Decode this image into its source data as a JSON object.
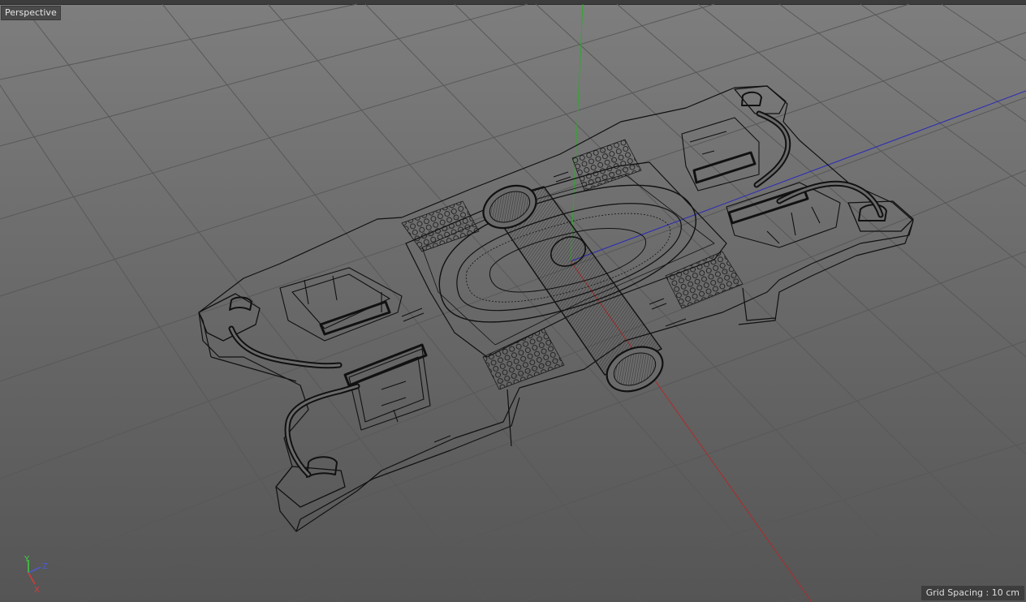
{
  "viewport": {
    "view_name": "Perspective",
    "grid_spacing": "Grid Spacing : 10 cm"
  },
  "axis_gizmo": {
    "y_label": "Y",
    "z_label": "Z",
    "x_label": "X",
    "y_color": "#3fd13f",
    "z_color": "#4a5ad8",
    "x_color": "#d83a3a"
  },
  "colors": {
    "grid_line": "#585858",
    "wire": "#111111",
    "axis_y": "#2fa82f",
    "axis_x": "#b02a2a",
    "axis_z": "#2a2ab8"
  },
  "icons": {
    "axis_gizmo": "xyz-axis-icon"
  }
}
